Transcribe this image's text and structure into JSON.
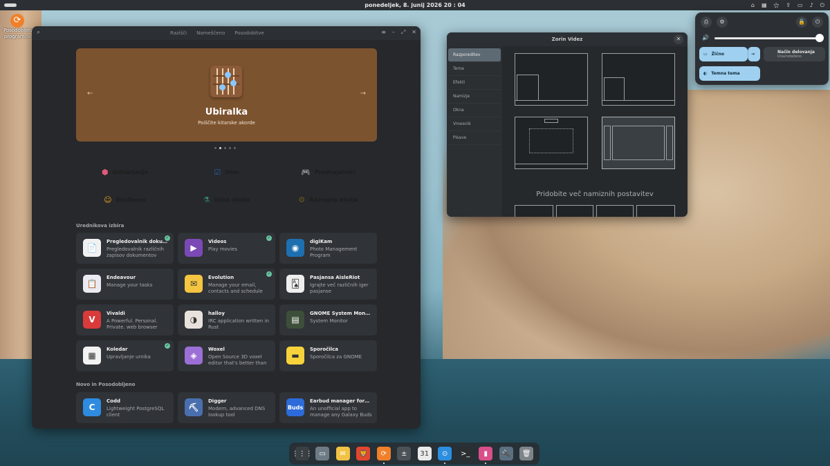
{
  "topbar": {
    "date": "ponedeljek, 8. junij 2026   20 : 04"
  },
  "desktop_icon": {
    "label": "Posodobitev programov"
  },
  "software": {
    "tabs": [
      "Razišči",
      "Nameščeno",
      "Posodobitve"
    ],
    "banner": {
      "title": "Ubiralka",
      "subtitle": "Poiščite kitarske akorde"
    },
    "categories": [
      {
        "label": "Ustvarjanje",
        "icon": "⬢",
        "color": "#dcc8f1"
      },
      {
        "label": "Delo",
        "icon": "☑",
        "color": "#c6e6f8"
      },
      {
        "label": "Predvajalniki",
        "icon": "🎮",
        "color": "#c8ecd8"
      },
      {
        "label": "Družbeno",
        "icon": "☺",
        "color": "#f7c9b6"
      },
      {
        "label": "Učna okolja",
        "icon": "⚗",
        "color": "#fbfbfb"
      },
      {
        "label": "Razvojna okolja",
        "icon": "⚙",
        "color": "#f8e58a"
      }
    ],
    "editors_choice_title": "Urednikova izbira",
    "editors_choice": [
      {
        "name": "Pregledovalnik dokument…",
        "desc": "Pregledovalnik različnih zapisov dokumentov",
        "icon": "📄",
        "bg": "#f1f1f1",
        "installed": true
      },
      {
        "name": "Videos",
        "desc": "Play movies",
        "icon": "▶",
        "bg": "#7b49b6",
        "installed": true
      },
      {
        "name": "digiKam",
        "desc": "Photo Management Program",
        "icon": "◉",
        "bg": "#1e6fb0",
        "installed": false
      },
      {
        "name": "Endeavour",
        "desc": "Manage your tasks",
        "icon": "📋",
        "bg": "#eaeaf2",
        "installed": false
      },
      {
        "name": "Evolution",
        "desc": "Manage your email, contacts and schedule",
        "icon": "✉",
        "bg": "#f5c542",
        "installed": true
      },
      {
        "name": "Pasjansa AisleRiot",
        "desc": "Igrajte več različnih iger pasjanse",
        "icon": "🂡",
        "bg": "#eeeeee",
        "installed": false
      },
      {
        "name": "Vivaldi",
        "desc": "A Powerful. Personal. Private. web browser",
        "icon": "V",
        "bg": "#d93a3a",
        "installed": false
      },
      {
        "name": "halloy",
        "desc": "IRC application written in Rust",
        "icon": "◑",
        "bg": "#e9e2dc",
        "installed": false
      },
      {
        "name": "GNOME System Monitor",
        "desc": "System Monitor",
        "icon": "▤",
        "bg": "#3d4f3a",
        "installed": false
      },
      {
        "name": "Koledar",
        "desc": "Upravljanje urnika",
        "icon": "▦",
        "bg": "#f2f2f2",
        "installed": true
      },
      {
        "name": "Woxel",
        "desc": "Open Source 3D voxel editor that's better than G…",
        "icon": "◈",
        "bg": "#9b6fd6",
        "installed": false
      },
      {
        "name": "Sporočilca",
        "desc": "Sporočilca za GNOME",
        "icon": "▬",
        "bg": "#f6d33b",
        "installed": false
      }
    ],
    "new_updated_title": "Novo in Posodobljeno",
    "new_updated": [
      {
        "name": "Codd",
        "desc": "Lightweight PostgreSQL client",
        "icon": "C",
        "bg": "#2e8be0",
        "installed": false
      },
      {
        "name": "Digger",
        "desc": "Modern, advanced DNS lookup tool",
        "icon": "⛏",
        "bg": "#4a6fae",
        "installed": false
      },
      {
        "name": "Earbud manager for Gala…",
        "desc": "An unofficial app to manage any Galaxy Buds device m…",
        "icon": "Buds",
        "bg": "#2c6bd9",
        "installed": false
      }
    ]
  },
  "zorin": {
    "title": "Zorin Videz",
    "sidebar": [
      "Razporeditev",
      "Tema",
      "Efekti",
      "Namizje",
      "Okna",
      "Vmesnik",
      "Pisave"
    ],
    "more_layouts": "Pridobite več namiznih postavitev"
  },
  "quick_settings": {
    "wired_label": "Žično",
    "mode_label": "Način delovanja",
    "mode_sub": "Uravnoteženo",
    "dark_label": "Temna tema",
    "volume": 0.95
  },
  "dock": [
    "⋮⋮⋮",
    "▭",
    "✉",
    "🦁",
    "⟳",
    "±",
    "31",
    "⊙",
    ">_",
    "▮",
    "🔌",
    "🗑"
  ]
}
